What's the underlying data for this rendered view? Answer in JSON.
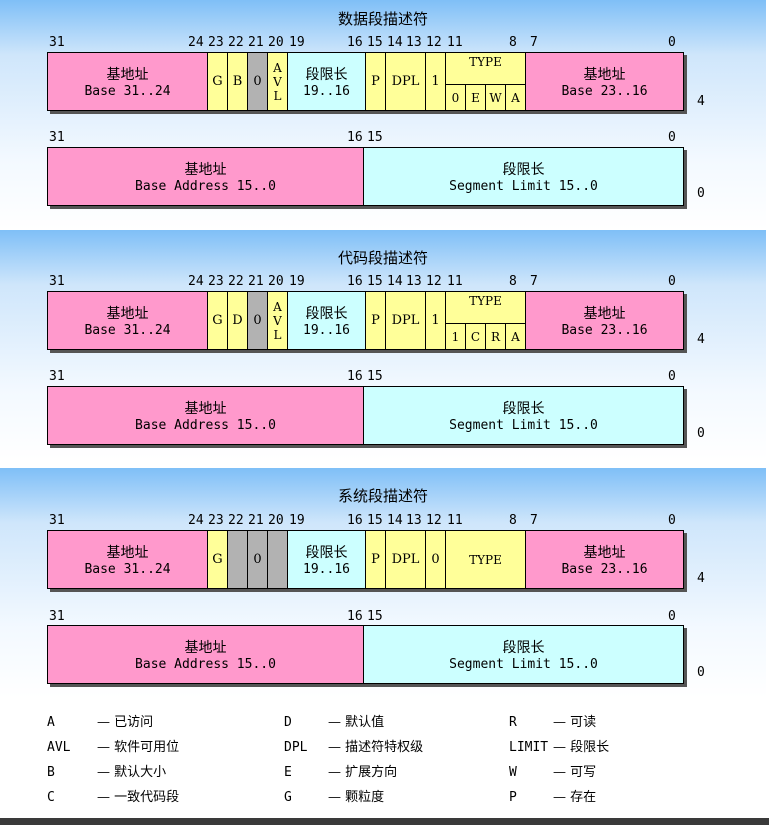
{
  "sections": [
    {
      "title": "数据段描述符",
      "high": {
        "bits": [
          "31",
          "24",
          "23",
          "22",
          "21",
          "20",
          "19",
          "16",
          "15",
          "14",
          "13",
          "12",
          "11",
          "8",
          "7",
          "0"
        ],
        "base_hi": {
          "cn": "基地址",
          "en": "Base 31..24"
        },
        "g": "G",
        "b": "B",
        "z": "0",
        "avl": [
          "A",
          "V",
          "L"
        ],
        "limit_hi": {
          "cn": "段限长",
          "en": "19..16"
        },
        "p": "P",
        "dpl": "DPL",
        "s": "1",
        "type_label": "TYPE",
        "type_bits": [
          "0",
          "E",
          "W",
          "A"
        ],
        "base_mid": {
          "cn": "基地址",
          "en": "Base 23..16"
        },
        "side": "4"
      },
      "low": {
        "bits": [
          "31",
          "16",
          "15",
          "0"
        ],
        "base": {
          "cn": "基地址",
          "en": "Base Address 15..0"
        },
        "limit": {
          "cn": "段限长",
          "en": "Segment Limit 15..0"
        },
        "side": "0"
      }
    },
    {
      "title": "代码段描述符",
      "high": {
        "bits": [
          "31",
          "24",
          "23",
          "22",
          "21",
          "20",
          "19",
          "16",
          "15",
          "14",
          "13",
          "12",
          "11",
          "8",
          "7",
          "0"
        ],
        "base_hi": {
          "cn": "基地址",
          "en": "Base 31..24"
        },
        "g": "G",
        "b": "D",
        "z": "0",
        "avl": [
          "A",
          "V",
          "L"
        ],
        "limit_hi": {
          "cn": "段限长",
          "en": "19..16"
        },
        "p": "P",
        "dpl": "DPL",
        "s": "1",
        "type_label": "TYPE",
        "type_bits": [
          "1",
          "C",
          "R",
          "A"
        ],
        "base_mid": {
          "cn": "基地址",
          "en": "Base 23..16"
        },
        "side": "4"
      },
      "low": {
        "bits": [
          "31",
          "16",
          "15",
          "0"
        ],
        "base": {
          "cn": "基地址",
          "en": "Base Address 15..0"
        },
        "limit": {
          "cn": "段限长",
          "en": "Segment Limit 15..0"
        },
        "side": "0"
      }
    },
    {
      "title": "系统段描述符",
      "high": {
        "bits": [
          "31",
          "24",
          "23",
          "22",
          "21",
          "20",
          "19",
          "16",
          "15",
          "14",
          "13",
          "12",
          "11",
          "8",
          "7",
          "0"
        ],
        "base_hi": {
          "cn": "基地址",
          "en": "Base 31..24"
        },
        "g": "G",
        "z": "0",
        "limit_hi": {
          "cn": "段限长",
          "en": "19..16"
        },
        "p": "P",
        "dpl": "DPL",
        "s": "0",
        "type_label": "TYPE",
        "base_mid": {
          "cn": "基地址",
          "en": "Base 23..16"
        },
        "side": "4"
      },
      "low": {
        "bits": [
          "31",
          "16",
          "15",
          "0"
        ],
        "base": {
          "cn": "基地址",
          "en": "Base Address 15..0"
        },
        "limit": {
          "cn": "段限长",
          "en": "Segment Limit 15..0"
        },
        "side": "0"
      }
    }
  ],
  "legend": [
    {
      "k": "A",
      "d": "— 已访问"
    },
    {
      "k": "D",
      "d": "— 默认值"
    },
    {
      "k": "R",
      "d": "— 可读"
    },
    {
      "k": "AVL",
      "d": "— 软件可用位"
    },
    {
      "k": "DPL",
      "d": "— 描述符特权级"
    },
    {
      "k": "LIMIT",
      "d": "— 段限长"
    },
    {
      "k": "B",
      "d": "— 默认大小"
    },
    {
      "k": "E",
      "d": "— 扩展方向"
    },
    {
      "k": "W",
      "d": "— 可写"
    },
    {
      "k": "C",
      "d": "— 一致代码段"
    },
    {
      "k": "G",
      "d": "— 颗粒度"
    },
    {
      "k": "P",
      "d": "— 存在"
    }
  ],
  "colors": {
    "pink": "#ff99cc",
    "yellow": "#ffff99",
    "cyan": "#ccffff",
    "gray": "#b2b2b2",
    "panel": "#7fbff7"
  }
}
